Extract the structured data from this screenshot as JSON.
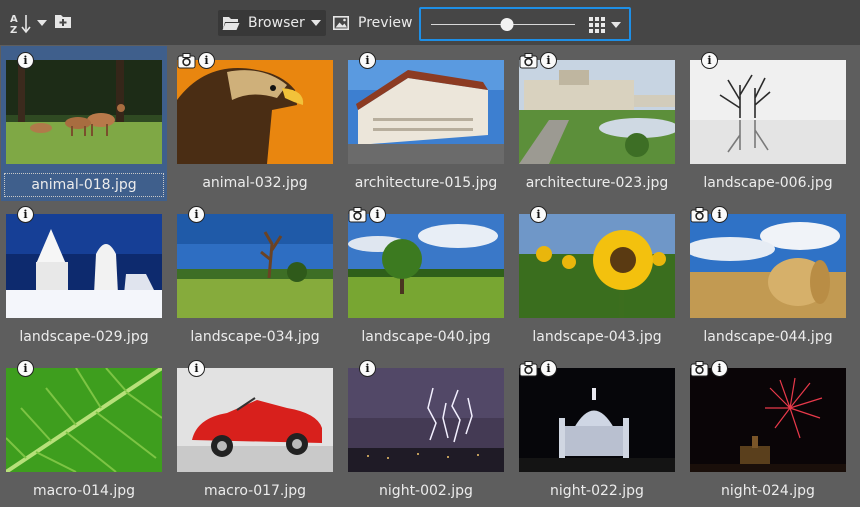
{
  "toolbar": {
    "sort_icon": "sort-az-icon",
    "add_folder_icon": "add-folder-icon",
    "browser_label": "Browser",
    "browser_icon": "folder-open-icon",
    "preview_label": "Preview",
    "preview_icon": "image-icon",
    "zoom_level": 0.53,
    "view_icon": "grid-view-icon"
  },
  "thumbnails": [
    {
      "name": "animal-018.jpg",
      "camera": false,
      "selected": true,
      "scene": "deer"
    },
    {
      "name": "animal-032.jpg",
      "camera": true,
      "selected": false,
      "scene": "eagle"
    },
    {
      "name": "architecture-015.jpg",
      "camera": false,
      "selected": false,
      "scene": "building"
    },
    {
      "name": "architecture-023.jpg",
      "camera": true,
      "selected": false,
      "scene": "palace"
    },
    {
      "name": "landscape-006.jpg",
      "camera": false,
      "selected": false,
      "scene": "fog-trees"
    },
    {
      "name": "landscape-029.jpg",
      "camera": false,
      "selected": false,
      "scene": "snow"
    },
    {
      "name": "landscape-034.jpg",
      "camera": false,
      "selected": false,
      "scene": "dead-tree"
    },
    {
      "name": "landscape-040.jpg",
      "camera": true,
      "selected": false,
      "scene": "green-tree"
    },
    {
      "name": "landscape-043.jpg",
      "camera": false,
      "selected": false,
      "scene": "sunflower"
    },
    {
      "name": "landscape-044.jpg",
      "camera": true,
      "selected": false,
      "scene": "hay-bale"
    },
    {
      "name": "macro-014.jpg",
      "camera": false,
      "selected": false,
      "scene": "leaf"
    },
    {
      "name": "macro-017.jpg",
      "camera": false,
      "selected": false,
      "scene": "red-car"
    },
    {
      "name": "night-002.jpg",
      "camera": false,
      "selected": false,
      "scene": "lightning"
    },
    {
      "name": "night-022.jpg",
      "camera": true,
      "selected": false,
      "scene": "night-church"
    },
    {
      "name": "night-024.jpg",
      "camera": true,
      "selected": false,
      "scene": "fireworks"
    }
  ],
  "colors": {
    "accent": "#1e8fe6",
    "selection": "#3f5f8c"
  }
}
